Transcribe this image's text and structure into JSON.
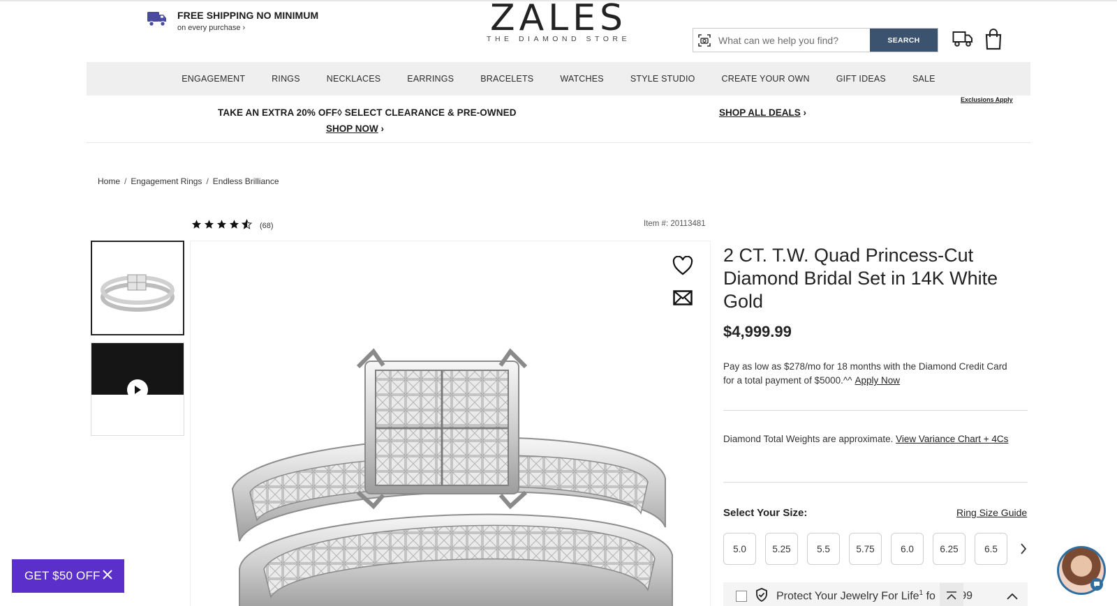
{
  "header": {
    "shipping_title": "FREE SHIPPING NO MINIMUM",
    "shipping_sub": "on every purchase ›",
    "logo_word": "ZALES",
    "logo_tagline": "THE DIAMOND STORE",
    "search_placeholder": "What can we help you find?",
    "search_button": "SEARCH"
  },
  "nav": {
    "items": [
      "ENGAGEMENT",
      "RINGS",
      "NECKLACES",
      "EARRINGS",
      "BRACELETS",
      "WATCHES",
      "STYLE STUDIO",
      "CREATE YOUR OWN",
      "GIFT IDEAS",
      "SALE"
    ]
  },
  "promo": {
    "headline": "TAKE AN EXTRA 20% OFF◊ SELECT CLEARANCE & PRE-OWNED",
    "shop_now": "SHOP NOW",
    "shop_all_deals": "SHOP ALL DEALS",
    "exclusions": "Exclusions Apply"
  },
  "breadcrumb": {
    "items": [
      "Home",
      "Engagement Rings",
      "Endless Brilliance"
    ],
    "separator": "/"
  },
  "product": {
    "rating": 4.5,
    "rating_count": "(68)",
    "item_number": "Item #: 20113481",
    "title": "2 CT. T.W. Quad Princess-Cut Diamond Bridal Set in 14K White Gold",
    "price": "$4,999.99",
    "finance_text": "Pay as low as $278/mo for 18 months with the Diamond Credit Card for a total payment of $5000.^^",
    "apply_now": "Apply Now",
    "weights_text": "Diamond Total Weights are approximate.",
    "variance_link": "View Variance Chart + 4Cs",
    "size_label": "Select Your Size:",
    "size_guide": "Ring Size Guide",
    "sizes": [
      "5.0",
      "5.25",
      "5.5",
      "5.75",
      "6.0",
      "6.25",
      "6.5"
    ],
    "protect_label": "Protect Your Jewelry For Life",
    "protect_sup": "1",
    "protect_fo": "fo",
    "protect_amount": "9.99"
  },
  "badges": {
    "get_off": "GET $50 OFF"
  },
  "colors": {
    "search_button": "#3c5370",
    "promo_badge": "#5b2fc9",
    "nav_background": "#efefef"
  }
}
